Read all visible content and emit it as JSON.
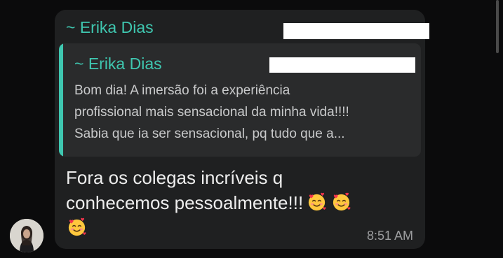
{
  "chat": {
    "message": {
      "sender_name": "~ Erika Dias",
      "quoted": {
        "sender_name": "~ Erika Dias",
        "text_lines": [
          "Bom dia! A imersão foi a experiência",
          "profissional mais sensacional da minha vida!!!!",
          "Sabia que ia ser sensacional, pq tudo que a..."
        ]
      },
      "text_line_1": "Fora os colegas incríveis q",
      "text_line_2": "conhecemos pessoalmente!!!",
      "emoji": "smiling-face-with-hearts",
      "time": "8:51 AM"
    }
  },
  "colors": {
    "background": "#0b0b0c",
    "bubble": "#1f2021",
    "quote_background": "#2a2b2c",
    "accent": "#3fc7b0",
    "message_text": "#ededed",
    "quote_text": "#c9cacb",
    "timestamp": "#9c9d9f"
  }
}
